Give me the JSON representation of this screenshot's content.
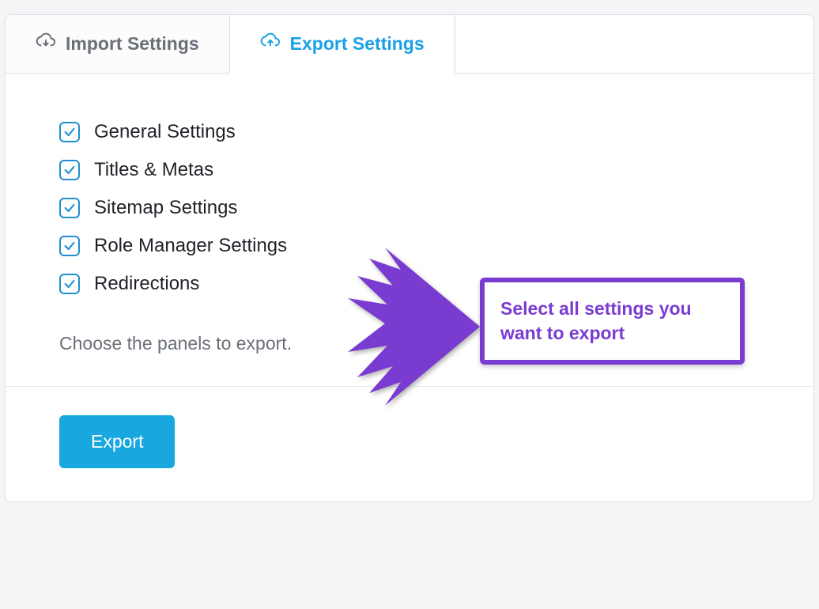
{
  "tabs": {
    "import": {
      "label": "Import Settings"
    },
    "export": {
      "label": "Export Settings"
    }
  },
  "checks": [
    {
      "label": "General Settings",
      "checked": true
    },
    {
      "label": "Titles & Metas",
      "checked": true
    },
    {
      "label": "Sitemap Settings",
      "checked": true
    },
    {
      "label": "Role Manager Settings",
      "checked": true
    },
    {
      "label": "Redirections",
      "checked": true
    }
  ],
  "helper_text": "Choose the panels to export.",
  "export_button": "Export",
  "annotation": "Select all settings you want to export",
  "colors": {
    "accent": "#19a7e0",
    "annotation": "#7a3bd1"
  }
}
